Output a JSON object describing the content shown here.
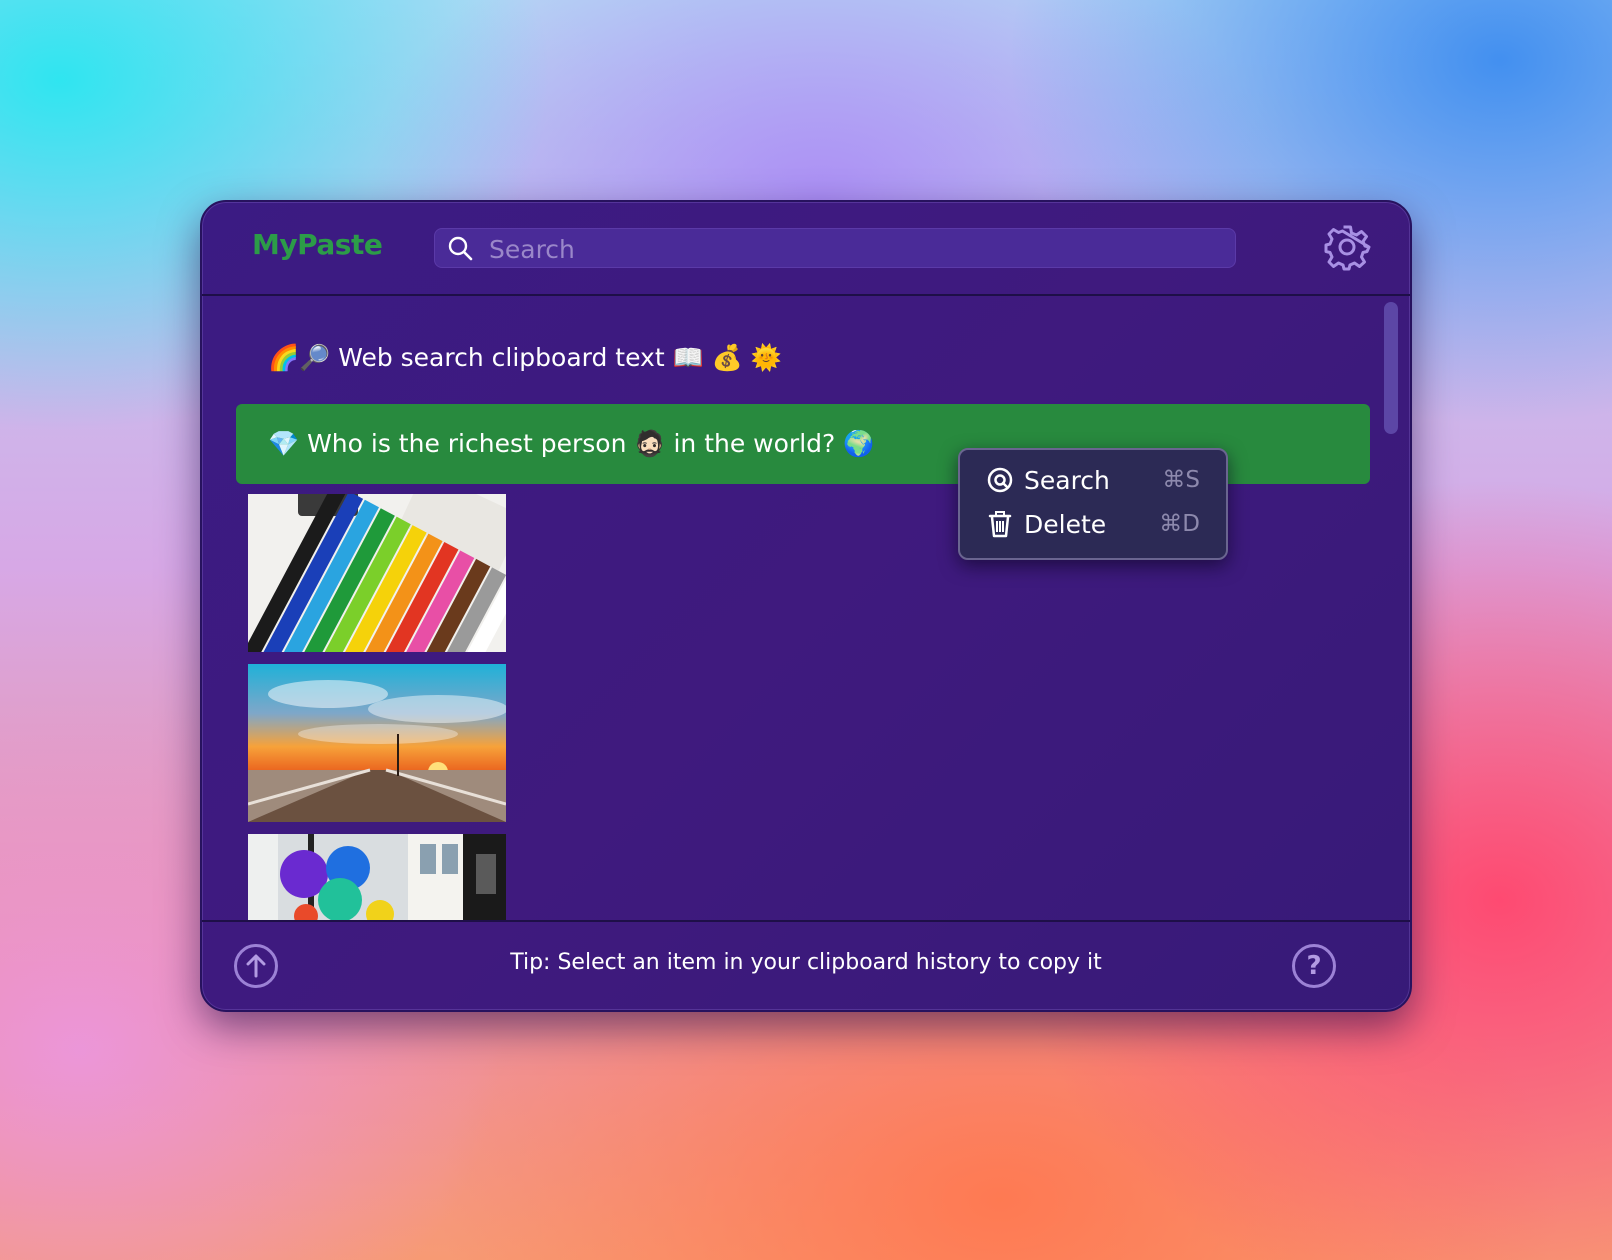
{
  "app": {
    "name": "MyPaste"
  },
  "search": {
    "placeholder": "Search"
  },
  "clipboard": {
    "items": [
      {
        "type": "text",
        "text": "🌈🔎 Web search clipboard text 📖 💰 🌞",
        "selected": false
      },
      {
        "type": "text",
        "text": "💎 Who is the richest person 🧔🏻 in the world? 🌍",
        "selected": true
      },
      {
        "type": "image",
        "description": "colored pencils"
      },
      {
        "type": "image",
        "description": "pier at sunset"
      },
      {
        "type": "image",
        "description": "colorful balloons"
      }
    ]
  },
  "context_menu": {
    "items": [
      {
        "label": "Search",
        "shortcut": "⌘S",
        "icon": "at-search-icon"
      },
      {
        "label": "Delete",
        "shortcut": "⌘D",
        "icon": "trash-icon"
      }
    ]
  },
  "footer": {
    "tip": "Tip: Select an item in your clipboard history to copy it",
    "up_icon": "arrow-up-circle-icon",
    "help_icon": "question-circle-icon"
  },
  "colors": {
    "window_bg": "#3b1b83",
    "selected_row": "#288a3e",
    "logo": "#2c9c48",
    "menu_bg": "#2c2a55"
  }
}
